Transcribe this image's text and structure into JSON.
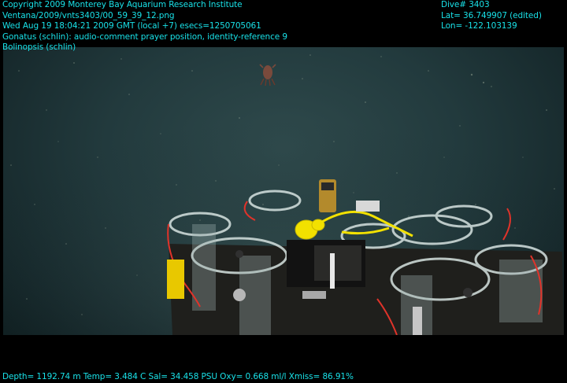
{
  "header_left": {
    "line1": "Copyright 2009 Monterey Bay Aquarium Research Institute",
    "line2": "Ventana/2009/vnts3403/00_59_39_12.png",
    "line3": "Wed Aug 19 18:04:21 2009 GMT (local +7)  esecs=1250705061",
    "line4": "Gonatus (schlin): audio-comment prayer position, identity-reference 9",
    "line5": "Bolinopsis (schlin)"
  },
  "header_right": {
    "dive": "Dive# 3403",
    "lat": "Lat= 36.749907 (edited)",
    "lon": "Lon= -122.103139"
  },
  "footer": {
    "telemetry": "Depth= 1192.74 m  Temp= 3.484 C  Sal= 34.458 PSU  Oxy= 0.668 ml/l  Xmiss= 86.91%"
  },
  "colors": {
    "overlay_text": "#19e1e8",
    "water": "#223a3d"
  }
}
